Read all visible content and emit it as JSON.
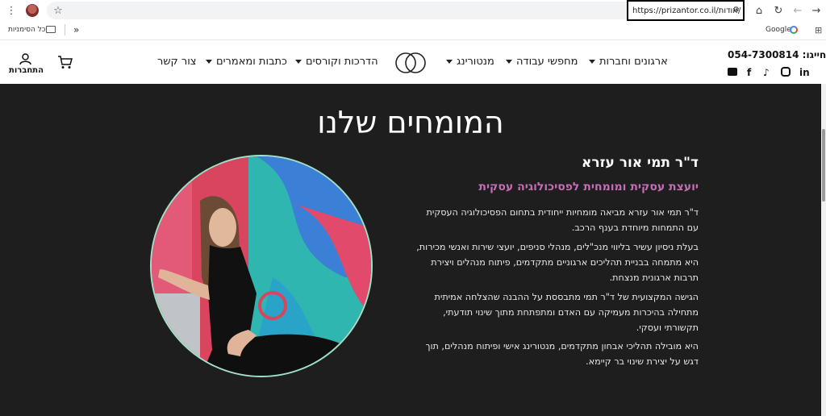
{
  "browser": {
    "url": "https://prizantor.co.il/אודות/",
    "menu_icon": "kebab-menu-icon",
    "bookmark_icon": "star-icon",
    "site_info_icon": "tune-icon",
    "home_icon": "home-icon",
    "reload_icon": "reload-icon",
    "back_icon": "back-arrow-icon",
    "forward_icon": "forward-arrow-icon"
  },
  "bookmarks": {
    "all_bookmarks_label": "כל הסימניות",
    "more_label": "»",
    "google_label": "Google",
    "apps_icon": "apps-grid-icon"
  },
  "header": {
    "phone": "חייגו: 054-7300814",
    "nav": [
      {
        "label": "ארגונים וחברות"
      },
      {
        "label": "מחפשי עבודה"
      },
      {
        "label": "מנטורינג"
      },
      {
        "label": "הדרכות וקורסים"
      },
      {
        "label": "כתבות ומאמרים"
      },
      {
        "label": "צור קשר"
      }
    ],
    "login_label": "התחברות",
    "social": [
      "in",
      "instagram",
      "tiktok",
      "f",
      "youtube"
    ]
  },
  "main": {
    "title": "המומחים שלנו",
    "name": "ד\"ר תמי אור עזרא",
    "role": "יועצת עסקית ומומחית לפסיכולוגיה עסקית",
    "paragraphs": [
      "ד\"ר תמי אור עזרא מביאה מומחיות ייחודית בתחום הפסיכולוגיה העסקית עם התמחות מיוחדת בענף הרכב.",
      "בעלת ניסיון עשיר בליווי מנכ\"לים, מנהלי סניפים, יועצי שירות ואנשי מכירות, היא מתמחה בבניית תהליכים ארגוניים מתקדמים, פיתוח מנהלים ויצירת תרבות ארגונית מנצחת.",
      "הגישה המקצועית של ד\"ר תמי מתבססת על ההבנה שהצלחה אמיתית מתחילה בהיכרות מעמיקה עם האדם ומתפתחת מתוך שינוי תודעתי, תקשורתי ועסקי.",
      "היא מובילה תהליכי אבחון מתקדמים, מנטורינג אישי ופיתוח מנהלים, תוך דגש על יצירת שינוי בר קיימא."
    ]
  },
  "colors": {
    "background_dark": "#1e1e1e",
    "accent_pink": "#c46eb4",
    "photo_border": "#9fe0c6"
  }
}
